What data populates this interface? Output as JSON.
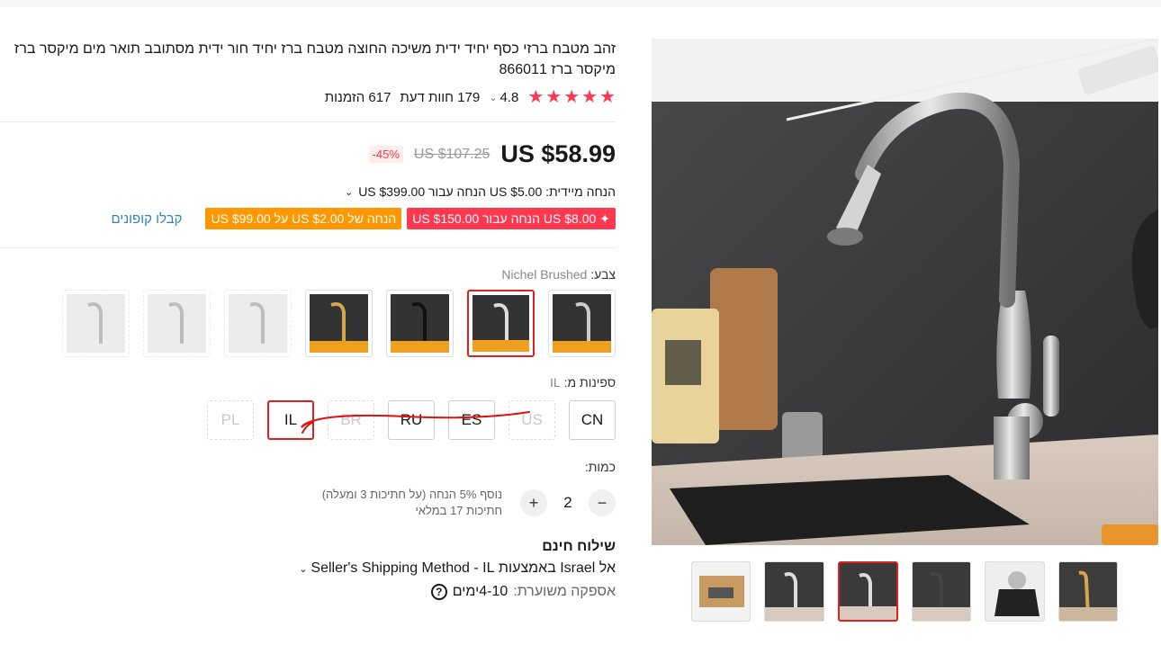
{
  "product": {
    "title": "זהב מטבח ברזי כסף יחיד ידית משיכה החוצה מטבח ברז יחיד חור ידית מסתובב תואר מים מיקסר ברז מיקסר ברז 866011",
    "rating": "4.8",
    "reviews_count": "179",
    "reviews_label": "חוות דעת",
    "orders_count": "617",
    "orders_label": "הזמנות"
  },
  "price": {
    "current": "US $58.99",
    "original": "US $107.25",
    "discount": "-45%"
  },
  "instant_discount": "הנחה מיידית: US $5.00 הנחה עבור US $399.00",
  "coupons": {
    "coupon_1": "US $8.00 הנחה עבור US $150.00",
    "coupon_1_icon": "sparkle-icon",
    "coupon_2": "הנחה של US $2.00 על US $99.00",
    "get_coupons": "קבלו קופונים"
  },
  "color": {
    "label": "צבע:",
    "selected": "Nichel Brushed",
    "options": [
      "Chrome Color",
      "Brushed Nickel",
      "Black Color",
      "Gold Color",
      "",
      "",
      ""
    ]
  },
  "ships_from": {
    "label": "ספינות מ:",
    "selected": "IL",
    "options": [
      "CN",
      "US",
      "ES",
      "RU",
      "BR",
      "IL",
      "PL"
    ]
  },
  "quantity": {
    "label": "כמות:",
    "value": "2",
    "minus": "−",
    "plus": "+",
    "note_line1": "נוסף 5% הנחה (על חתיכות 3 ומעלה)",
    "note_line2": "חתיכות 17 במלאי"
  },
  "shipping": {
    "free_label": "שילוח חינם",
    "method": "אל Israel באמצעות Seller's Shipping Method - IL",
    "delivery_label": "אספקה משוערת:",
    "delivery_days": "4-10",
    "delivery_unit": "ימים"
  },
  "colors": {
    "accent_red": "#fd384f",
    "accent_orange": "#ff9800",
    "link_blue": "#3084b6"
  }
}
